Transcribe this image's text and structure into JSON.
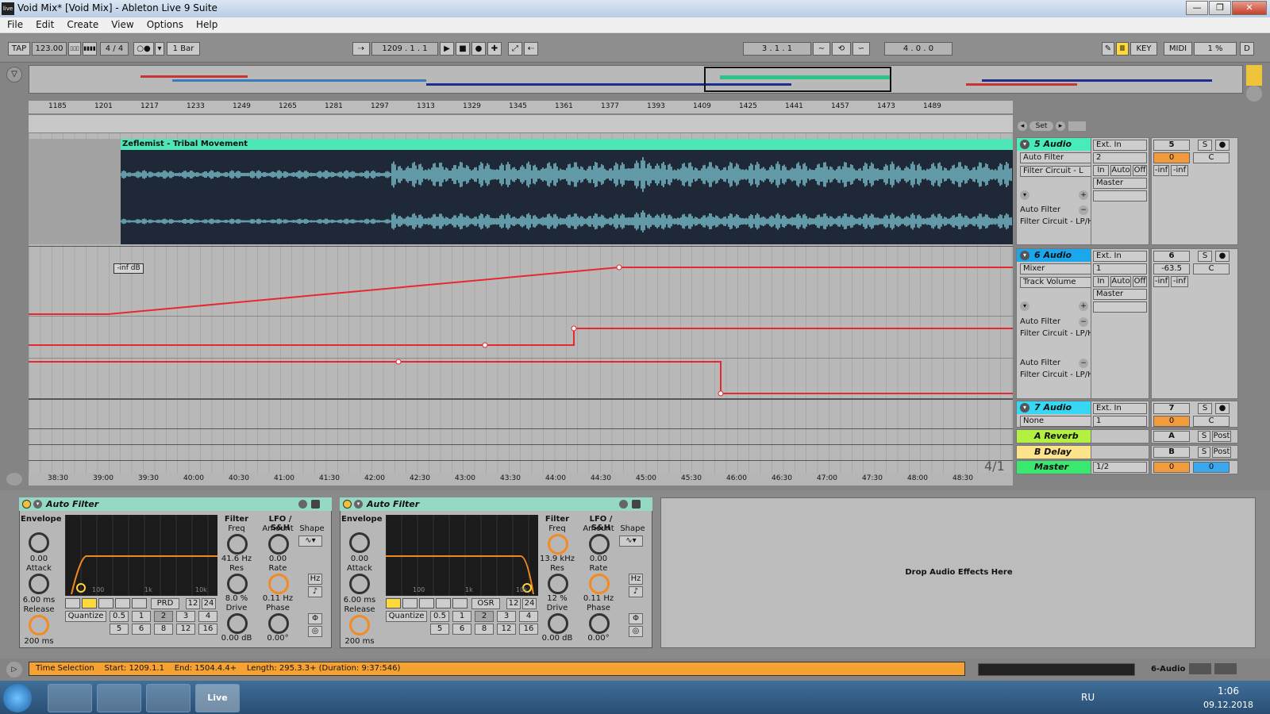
{
  "window": {
    "title": "Void Mix*  [Void Mix] - Ableton Live 9 Suite",
    "minimize": "—",
    "maximize": "❐",
    "close": "✕",
    "app_icon": "live"
  },
  "menu": [
    "File",
    "Edit",
    "Create",
    "View",
    "Options",
    "Help"
  ],
  "control_bar": {
    "tap": "TAP",
    "tempo": "123.00",
    "nudge_down": "▯▯▯",
    "nudge_up": "▮▮▮▮",
    "signature": "4  /  4",
    "metronome": "○●",
    "quantize": "1 Bar",
    "follow_icon": "⇢",
    "position": "1209 .    1 .    1",
    "play": "▶",
    "stop": "■",
    "record": "●",
    "overdub": "✚",
    "loop_start": "3 .    1 .    1",
    "loop_length": "4 .    0 .    0",
    "key": "KEY",
    "midi": "MIDI",
    "cpu": "1 %",
    "d": "D"
  },
  "ruler_bars": [
    "1185",
    "1201",
    "1217",
    "1233",
    "1249",
    "1265",
    "1281",
    "1297",
    "1313",
    "1329",
    "1345",
    "1361",
    "1377",
    "1393",
    "1409",
    "1425",
    "1441",
    "1457",
    "1473",
    "1489"
  ],
  "time_ruler": [
    "38:30",
    "39:00",
    "39:30",
    "40:00",
    "40:30",
    "41:00",
    "41:30",
    "42:00",
    "42:30",
    "43:00",
    "43:30",
    "44:00",
    "44:30",
    "45:00",
    "45:30",
    "46:00",
    "46:30",
    "47:00",
    "47:30",
    "48:00",
    "48:30"
  ],
  "set_button": "Set",
  "clip": {
    "name": "Zeflemist - Tribal Movement"
  },
  "automation_label": "-inf dB",
  "time_sig_marker": "4/1",
  "tracks": [
    {
      "name": "5 Audio",
      "color": "#48ecbb",
      "input": "Ext. In",
      "channel": "2",
      "num": "5",
      "vol": "0",
      "device": "Auto Filter",
      "param": "Filter Circuit - L",
      "lane1": "Auto Filter",
      "lane1b": "Filter Circuit - LP/H",
      "out": "Master",
      "in": "In",
      "auto": "Auto",
      "off": "Off",
      "inf1": "-inf",
      "inf2": "-inf",
      "pan": "C",
      "s": "S"
    },
    {
      "name": "6 Audio",
      "color": "#1aa7ee",
      "input": "Ext. In",
      "channel": "1",
      "num": "6",
      "vol": "-63.5",
      "device": "Mixer",
      "param": "Track Volume",
      "lane1": "Auto Filter",
      "lane1b": "Filter Circuit - LP/H",
      "lane2": "Auto Filter",
      "lane2b": "Filter Circuit - LP/H",
      "out": "Master",
      "in": "In",
      "auto": "Auto",
      "off": "Off",
      "inf1": "-inf",
      "inf2": "-inf",
      "pan": "C",
      "s": "S"
    },
    {
      "name": "7 Audio",
      "color": "#36d7f2",
      "input": "Ext. In",
      "channel": "1",
      "num": "7",
      "vol": "0",
      "device": "None",
      "pan": "C",
      "s": "S"
    },
    {
      "name": "A Reverb",
      "color": "#b4f040",
      "num": "A",
      "s": "S",
      "post": "Post"
    },
    {
      "name": "B Delay",
      "color": "#fde38a",
      "num": "B",
      "s": "S",
      "post": "Post"
    },
    {
      "name": "Master",
      "color": "#39e86e",
      "out": "1/2",
      "vol": "0",
      "vol2": "0"
    }
  ],
  "devices": [
    {
      "title": "Auto Filter",
      "envelope": "Envelope",
      "env_val": "0.00",
      "attack": "Attack",
      "attack_val": "6.00 ms",
      "release": "Release",
      "release_val": "200 ms",
      "filter": "Filter",
      "freq": "Freq",
      "freq_val": "41.6 Hz",
      "res": "Res",
      "res_val": "8.0 %",
      "drive": "Drive",
      "drive_val": "0.00 dB",
      "lfo": "LFO / S&H",
      "amount": "Amount",
      "amount_val": "0.00",
      "shape": "Shape",
      "rate": "Rate",
      "rate_val": "0.11 Hz",
      "phase": "Phase",
      "phase_val": "0.00°",
      "hz": "Hz",
      "mode": "PRD",
      "n12": "12",
      "n24": "24",
      "quantize": "Quantize",
      "q": [
        "0.5",
        "1",
        "2",
        "3",
        "4",
        "5",
        "6",
        "8",
        "12",
        "16"
      ],
      "axis": [
        "100",
        "1k",
        "10k"
      ]
    },
    {
      "title": "Auto Filter",
      "envelope": "Envelope",
      "env_val": "0.00",
      "attack": "Attack",
      "attack_val": "6.00 ms",
      "release": "Release",
      "release_val": "200 ms",
      "filter": "Filter",
      "freq": "Freq",
      "freq_val": "13.9 kHz",
      "res": "Res",
      "res_val": "12 %",
      "drive": "Drive",
      "drive_val": "0.00 dB",
      "lfo": "LFO / S&H",
      "amount": "Amount",
      "amount_val": "0.00",
      "shape": "Shape",
      "rate": "Rate",
      "rate_val": "0.11 Hz",
      "phase": "Phase",
      "phase_val": "0.00°",
      "hz": "Hz",
      "mode": "OSR",
      "n12": "12",
      "n24": "24",
      "quantize": "Quantize",
      "q": [
        "0.5",
        "1",
        "2",
        "3",
        "4",
        "5",
        "6",
        "8",
        "12",
        "16"
      ],
      "axis": [
        "100",
        "1k",
        "10k"
      ]
    }
  ],
  "drop_zone": "Drop Audio Effects Here",
  "status": {
    "label": "Time Selection",
    "start": "Start: 1209.1.1",
    "end": "End: 1504.4.4+",
    "length": "Length: 295.3.3+ (Duration: 9:37:546)",
    "track": "6-Audio"
  },
  "taskbar": {
    "lang": "RU",
    "time": "1:06",
    "date": "09.12.2018"
  }
}
